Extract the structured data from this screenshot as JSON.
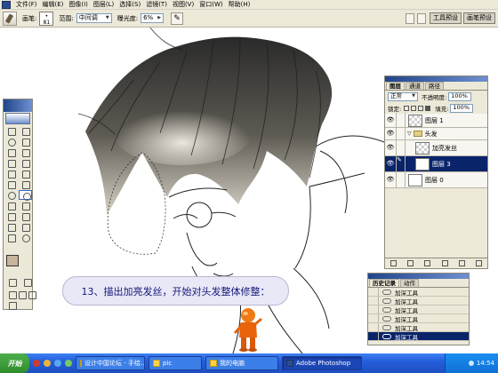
{
  "menubar": {
    "items": [
      "文件(F)",
      "编辑(E)",
      "图像(I)",
      "图层(L)",
      "选择(S)",
      "滤镜(T)",
      "视图(V)",
      "窗口(W)",
      "帮助(H)"
    ]
  },
  "options": {
    "brush_label": "画笔:",
    "brush_size": "81",
    "range_label": "范围:",
    "range_value": "中间调",
    "exposure_label": "曝光度:",
    "exposure_value": "6%",
    "tool_presets": "工具预设",
    "palette_well": "画笔预设"
  },
  "layers": {
    "tabs": [
      "图层",
      "通道",
      "路径"
    ],
    "blend_mode": "正常",
    "opacity_label": "不透明度:",
    "opacity_value": "100%",
    "lock_label": "锁定:",
    "fill_label": "填充:",
    "fill_value": "100%",
    "rows": [
      "图层 1",
      "头发",
      "加亮发丝",
      "图层 3",
      "图层 0"
    ]
  },
  "history": {
    "tabs": [
      "历史记录",
      "动作"
    ],
    "items": [
      "加深工具",
      "加深工具",
      "加深工具",
      "加深工具",
      "加深工具",
      "加深工具"
    ]
  },
  "caption": "13、描出加亮发丝，开始对头发整体修整：",
  "taskbar": {
    "start": "开始",
    "tasks": [
      "设计中国论坛 - 手绘...",
      "pic",
      "我的电脑",
      "Adobe Photoshop"
    ],
    "clock": "14:54"
  },
  "colors": {
    "foreground": "#c8b49a",
    "background": "#ffffff",
    "caption_text": "#17177a",
    "selection": "#0a246a"
  }
}
